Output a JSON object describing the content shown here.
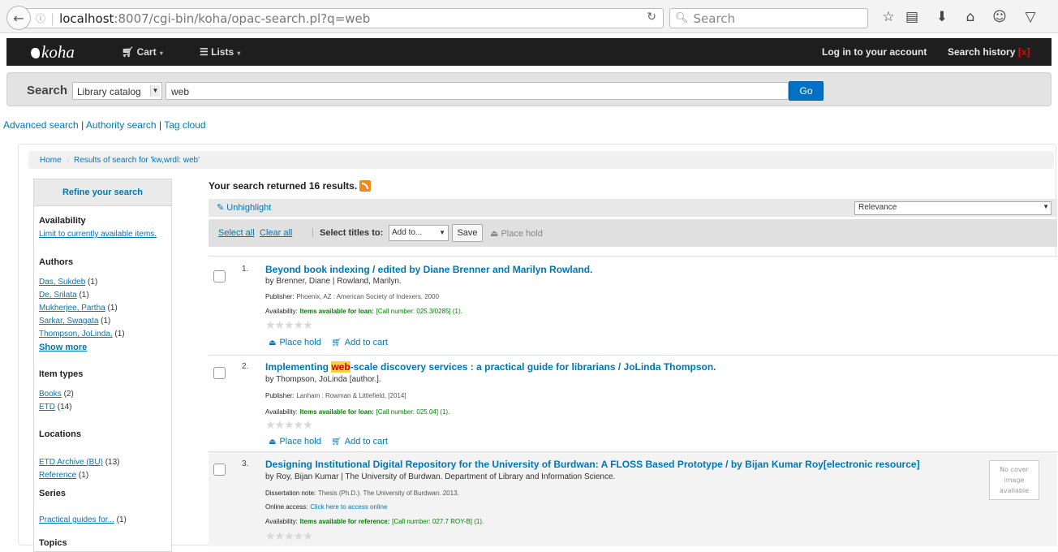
{
  "browser": {
    "url_host": "localhost",
    "url_rest": ":8007/cgi-bin/koha/opac-search.pl?q=web",
    "search_placeholder": "Search",
    "back_icon": "back-arrow-icon"
  },
  "nav": {
    "logo": "koha",
    "cart": "Cart",
    "lists": "Lists",
    "login": "Log in to your account",
    "history": "Search history",
    "history_open": "[",
    "history_x": "x",
    "history_close": "]"
  },
  "search": {
    "label": "Search",
    "scope": "Library catalog",
    "query": "web",
    "go": "Go"
  },
  "links": {
    "advanced": "Advanced search",
    "authority": "Authority search",
    "tagcloud": "Tag cloud",
    "sep": "|"
  },
  "breadcrumb": {
    "home": "Home",
    "results": "Results of search for 'kw,wrdl: web'"
  },
  "sidebar": {
    "title": "Refine your search",
    "availability_hd": "Availability",
    "availability_link": "Limit to currently available items.",
    "authors_hd": "Authors",
    "authors": [
      {
        "name": "Das, Sukdeb",
        "count": "(1)"
      },
      {
        "name": "De, Srilata",
        "count": "(1)"
      },
      {
        "name": "Mukherjee, Partha",
        "count": "(1)"
      },
      {
        "name": "Sarkar, Swagata",
        "count": "(1)"
      },
      {
        "name": "Thompson, JoLinda,",
        "count": "(1)"
      }
    ],
    "show_more": "Show more",
    "itemtypes_hd": "Item types",
    "itemtypes": [
      {
        "name": "Books",
        "count": "(2)"
      },
      {
        "name": "ETD",
        "count": "(14)"
      }
    ],
    "locations_hd": "Locations",
    "locations": [
      {
        "name": "ETD Archive (BU)",
        "count": "(13)"
      },
      {
        "name": "Reference",
        "count": "(1)"
      }
    ],
    "series_hd": "Series",
    "series": [
      {
        "name": "Practical guides for...",
        "count": "(1)"
      }
    ],
    "topics_hd": "Topics"
  },
  "results": {
    "summary": "Your search returned 16 results.",
    "unhighlight": "Unhighlight",
    "sort": "Relevance",
    "select_all": "Select all",
    "clear_all": "Clear all",
    "pipe": "|",
    "select_titles": "Select titles to:",
    "add_to": "Add to...",
    "save": "Save",
    "place_hold": "Place hold",
    "items": [
      {
        "num": "1.",
        "title": "Beyond book indexing / edited by Diane Brenner and Marilyn Rowland.",
        "by": "by Brenner, Diane | Rowland, Marilyn.",
        "publisher_label": "Publisher:",
        "publisher": "Phoenix, AZ : American Society of Indexers, 2000",
        "avail_label": "Availability:",
        "avail_status": "Items available for loan:",
        "avail_detail": "[Call number: 025.3/0285] (1).",
        "place_hold": "Place hold",
        "add_cart": "Add to cart"
      },
      {
        "num": "2.",
        "title_pre": "Implementing ",
        "title_hl": "web",
        "title_post": "-scale discovery services : a practical guide for librarians / JoLinda Thompson.",
        "by": "by Thompson, JoLinda [author.].",
        "publisher_label": "Publisher:",
        "publisher": "Lanham : Rowman & Littlefield, [2014]",
        "avail_label": "Availability:",
        "avail_status": "Items available for loan:",
        "avail_detail": "[Call number: 025.04] (1).",
        "place_hold": "Place hold",
        "add_cart": "Add to cart"
      },
      {
        "num": "3.",
        "title": "Designing Institutional Digital Repository for the University of Burdwan: A FLOSS Based Prototype / by Bijan Kumar Roy[electronic resource]",
        "by": "by Roy, Bijan Kumar | The University of Burdwan. Department of Library and Information Science.",
        "diss_label": "Dissertation note:",
        "diss": "Thesis (Ph.D.). The University of Burdwan. 2013.",
        "online_label": "Online access:",
        "online": "Click here to access online",
        "avail_label": "Availability:",
        "avail_status": "Items available for reference:",
        "avail_detail": "[Call number: 027.7 ROY-B] (1).",
        "nocover_1": "No cover",
        "nocover_2": "image",
        "nocover_3": "available"
      }
    ]
  },
  "colors": {
    "link": "#0076b2",
    "navbar": "#1e1e1e",
    "go_button": "#0071c5",
    "available": "#008000",
    "highlight": "#fbd23c"
  }
}
